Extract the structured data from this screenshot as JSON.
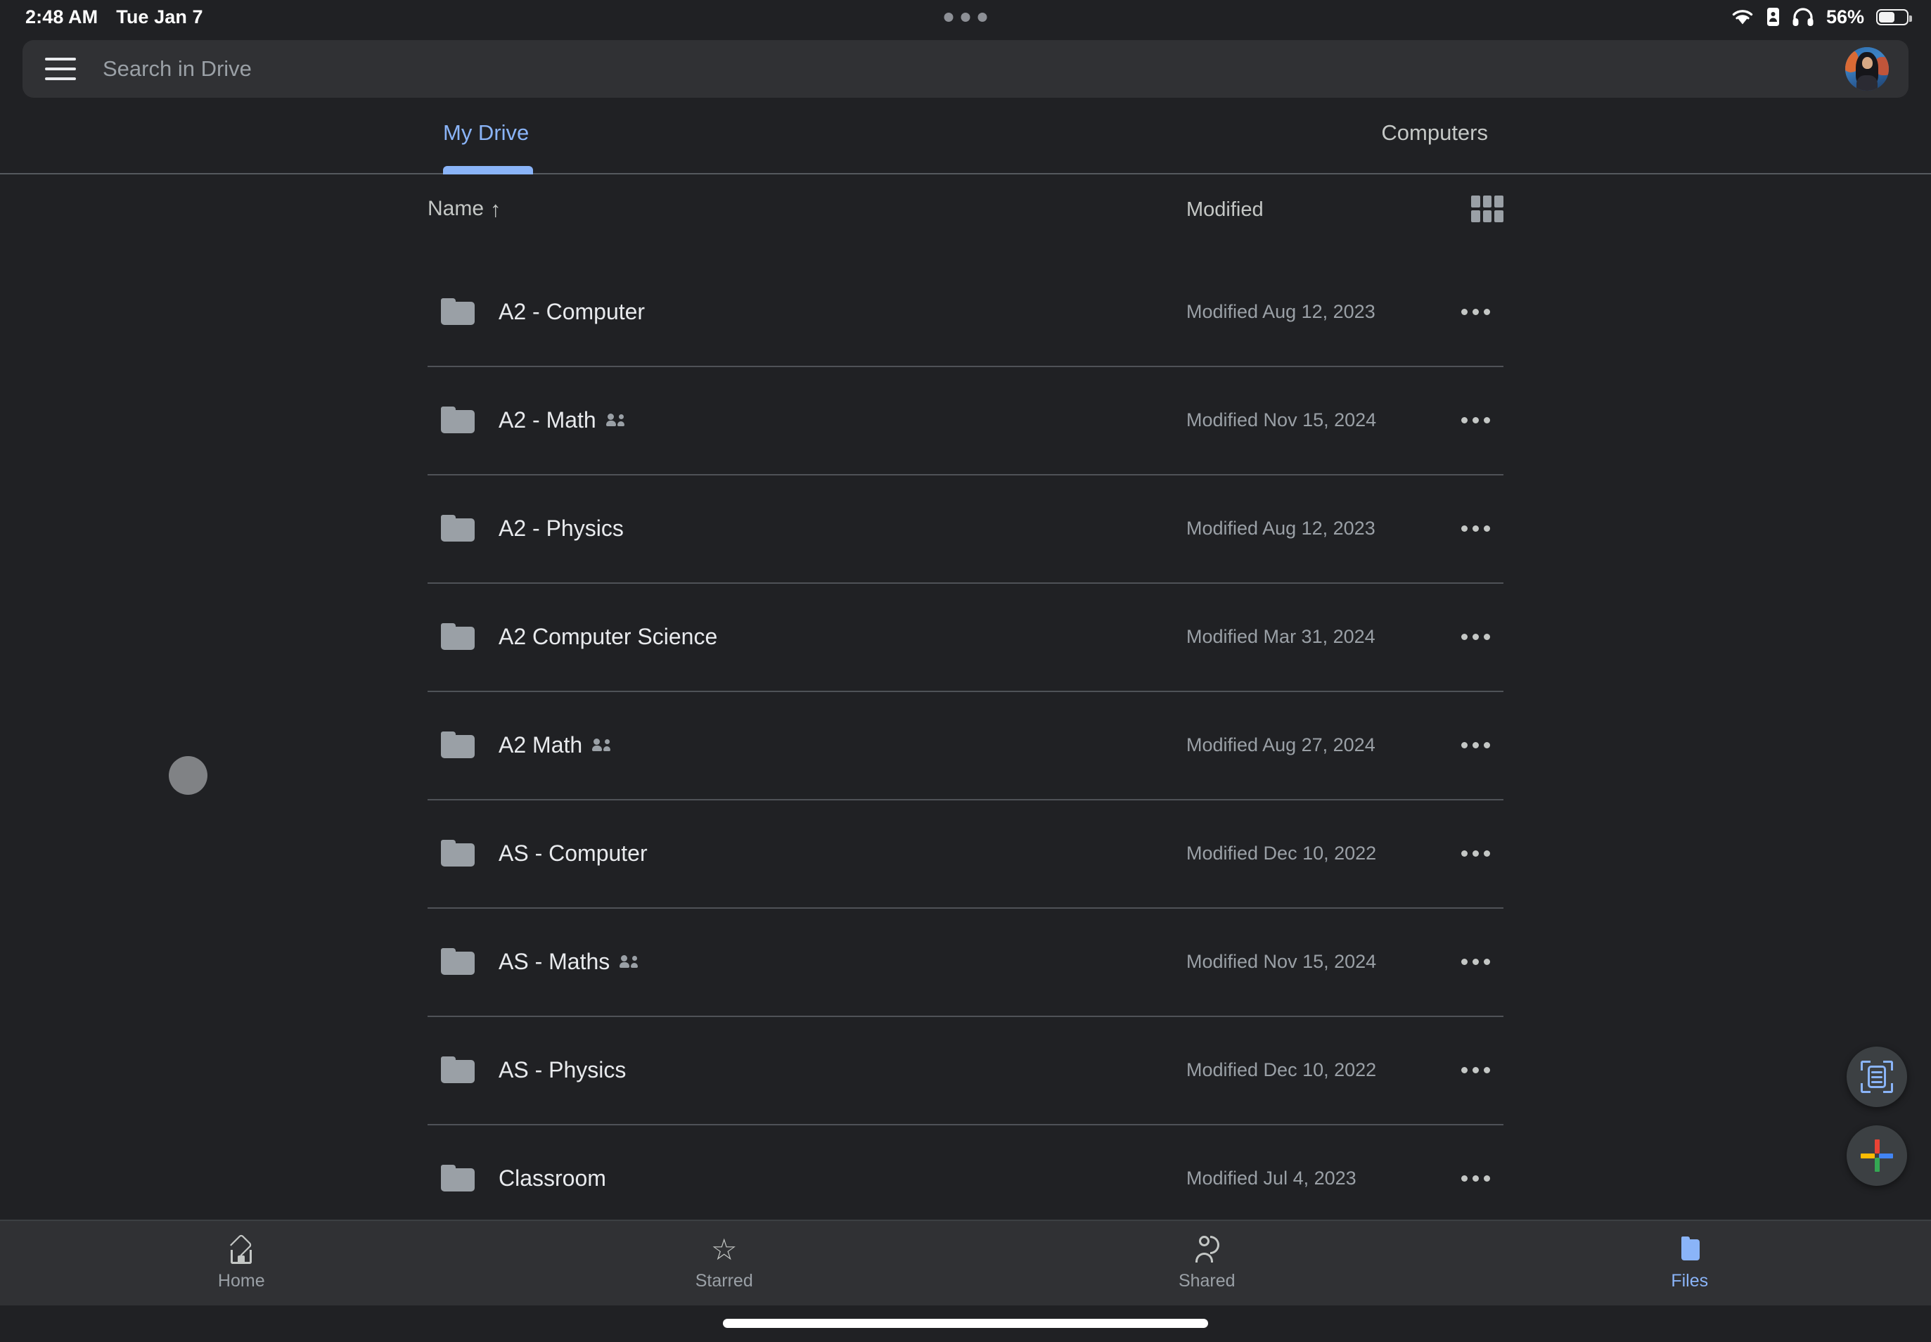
{
  "status_bar": {
    "time": "2:48 AM",
    "date": "Tue Jan 7",
    "battery_percent": "56%",
    "icons": [
      "wifi-icon",
      "battery-share-icon",
      "headphones-icon",
      "battery-icon"
    ],
    "multitask_handle": "three-dots-handle"
  },
  "search": {
    "placeholder": "Search in Drive",
    "menu_icon": "hamburger-menu-icon",
    "avatar": "user-avatar"
  },
  "tabs": [
    {
      "label": "My Drive",
      "active": true
    },
    {
      "label": "Computers",
      "active": false
    }
  ],
  "list_header": {
    "name_label": "Name",
    "sort_arrow": "↑",
    "modified_label": "Modified",
    "view_toggle_icon": "grid-view-icon"
  },
  "files": [
    {
      "name": "A2 - Computer",
      "shared": false,
      "modified": "Modified Aug 12, 2023",
      "icon": "folder-icon"
    },
    {
      "name": "A2 - Math",
      "shared": true,
      "modified": "Modified Nov 15, 2024",
      "icon": "folder-icon"
    },
    {
      "name": "A2 - Physics",
      "shared": false,
      "modified": "Modified Aug 12, 2023",
      "icon": "folder-icon"
    },
    {
      "name": "A2 Computer Science",
      "shared": false,
      "modified": "Modified Mar 31, 2024",
      "icon": "folder-icon"
    },
    {
      "name": "A2 Math",
      "shared": true,
      "modified": "Modified Aug 27, 2024",
      "icon": "folder-icon"
    },
    {
      "name": "AS - Computer",
      "shared": false,
      "modified": "Modified Dec 10, 2022",
      "icon": "folder-icon"
    },
    {
      "name": "AS - Maths",
      "shared": true,
      "modified": "Modified Nov 15, 2024",
      "icon": "folder-icon"
    },
    {
      "name": "AS - Physics",
      "shared": false,
      "modified": "Modified Dec 10, 2022",
      "icon": "folder-icon"
    },
    {
      "name": "Classroom",
      "shared": false,
      "modified": "Modified Jul 4, 2023",
      "icon": "folder-icon"
    }
  ],
  "fabs": [
    {
      "name": "scan-fab",
      "icon": "document-scan-icon"
    },
    {
      "name": "new-fab",
      "icon": "google-plus-icon"
    }
  ],
  "bottom_nav": [
    {
      "label": "Home",
      "icon": "home-icon",
      "active": false
    },
    {
      "label": "Starred",
      "icon": "star-icon",
      "active": false
    },
    {
      "label": "Shared",
      "icon": "people-icon",
      "active": false
    },
    {
      "label": "Files",
      "icon": "folder-icon",
      "active": true
    }
  ],
  "colors": {
    "background": "#202124",
    "surface": "#303134",
    "accent": "#8ab4f8",
    "text_primary": "#e8eaed",
    "text_secondary": "#9aa0a6",
    "divider": "#5f6368",
    "google_red": "#ea4335",
    "google_blue": "#4285f4",
    "google_green": "#34a853",
    "google_yellow": "#fbbc04"
  }
}
